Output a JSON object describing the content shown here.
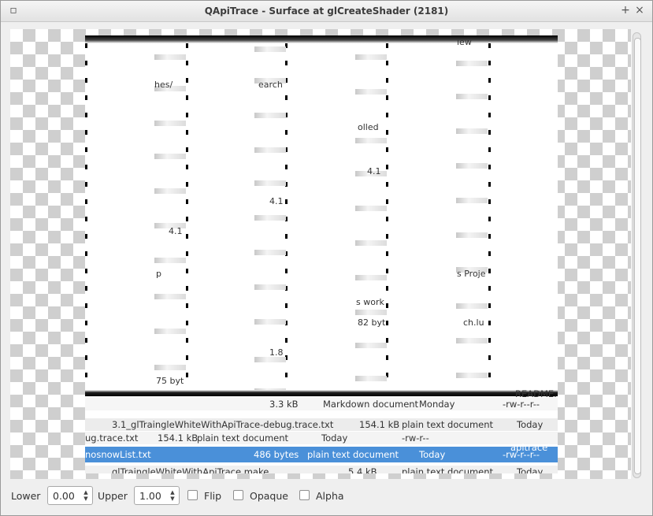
{
  "window": {
    "title": "QApiTrace - Surface at glCreateShader (2181)"
  },
  "surface": {
    "ghost_texts": [
      "iew",
      "hes/",
      "earch",
      "olled",
      "4.1",
      "4.1",
      "4.1",
      "p",
      "s Proje",
      "s work",
      "82 byt",
      "ch.lu",
      "1.8",
      "75 byt"
    ],
    "files": [
      {
        "name": "",
        "size": "3.3 kB",
        "type": "Markdown document",
        "date": "Monday",
        "perm": "-rw-r--r--",
        "other": "README."
      },
      {
        "name": "3.1_glTraingleWhiteWithApiTrace-debug.trace.txt",
        "size": "154.1 kB",
        "type": "plain text document",
        "date": "Today",
        "perm": "",
        "other": ""
      },
      {
        "name": "ug.trace.txt",
        "size": "154.1 kB",
        "type": "plain text document",
        "date": "Today",
        "perm": "-rw-r--",
        "other": ""
      },
      {
        "name": "nosnowList.txt",
        "size": "486 bytes",
        "type": "plain text document",
        "date": "Today",
        "perm": "-rw-r--r--",
        "other": "apitrace'"
      },
      {
        "name": "glTraingleWhiteWithApiTrace.make",
        "size": "5.4 kB",
        "type": "plain text document",
        "date": "Today",
        "perm": "",
        "other": ""
      }
    ]
  },
  "controls": {
    "lower_label": "Lower",
    "lower_value": "0.00",
    "upper_label": "Upper",
    "upper_value": "1.00",
    "flip_label": "Flip",
    "opaque_label": "Opaque",
    "alpha_label": "Alpha"
  }
}
